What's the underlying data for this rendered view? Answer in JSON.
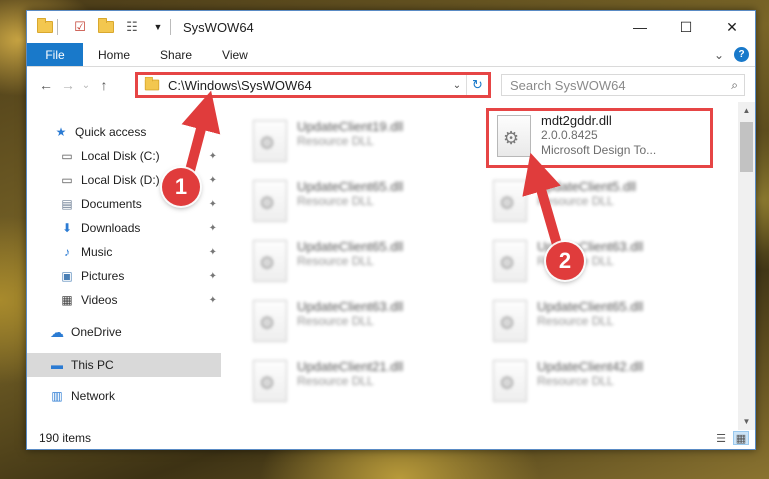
{
  "window": {
    "title": "SysWOW64",
    "controls": {
      "minimize": "—",
      "maximize": "☐",
      "close": "✕"
    }
  },
  "ribbon": {
    "tabs": [
      "File",
      "Home",
      "Share",
      "View"
    ],
    "collapse_glyph": "⌄",
    "help_glyph": "?"
  },
  "navigation": {
    "back": "←",
    "forward": "→",
    "recent": "⌄",
    "up": "↑"
  },
  "address": {
    "path": "C:\\Windows\\SysWOW64",
    "dropdown_glyph": "⌄",
    "refresh_glyph": "↻"
  },
  "search": {
    "placeholder": "Search SysWOW64",
    "icon": "⌕"
  },
  "nav_pane": {
    "items": [
      {
        "label": "Quick access",
        "icon": "★"
      },
      {
        "label": "Local Disk (C:)",
        "icon": "▭"
      },
      {
        "label": "Local Disk (D:)",
        "icon": "▭"
      },
      {
        "label": "Documents",
        "icon": "▤"
      },
      {
        "label": "Downloads",
        "icon": "⬇"
      },
      {
        "label": "Music",
        "icon": "♪"
      },
      {
        "label": "Pictures",
        "icon": "▣"
      },
      {
        "label": "Videos",
        "icon": "▦"
      },
      {
        "label": "OneDrive",
        "icon": "☁"
      },
      {
        "label": "This PC",
        "icon": "▬"
      },
      {
        "label": "Network",
        "icon": "▥"
      }
    ],
    "pin_glyph": "📌"
  },
  "files": [
    {
      "name": "UpdateClient19.dll",
      "sub": "Resource DLL"
    },
    {
      "name": "mdt2gddr.dll",
      "sub": "2.0.0.8425",
      "sub2": "Microsoft Design To..."
    },
    {
      "name": "UpdateClient65.dll",
      "sub": "Resource DLL"
    },
    {
      "name": "UpdateClient5.dll",
      "sub": "Resource DLL"
    },
    {
      "name": "UpdateClient65.dll",
      "sub": "Resource DLL"
    },
    {
      "name": "UpdateClient63.dll",
      "sub": "Resource DLL"
    },
    {
      "name": "UpdateClient63.dll",
      "sub": "Resource DLL"
    },
    {
      "name": "UpdateClient65.dll",
      "sub": "Resource DLL"
    },
    {
      "name": "UpdateClient21.dll",
      "sub": "Resource DLL"
    },
    {
      "name": "UpdateClient42.dll",
      "sub": "Resource DLL"
    }
  ],
  "status": {
    "item_count": "190 items"
  },
  "annotations": {
    "marker1": "1",
    "marker2": "2",
    "color": "#e64545"
  }
}
